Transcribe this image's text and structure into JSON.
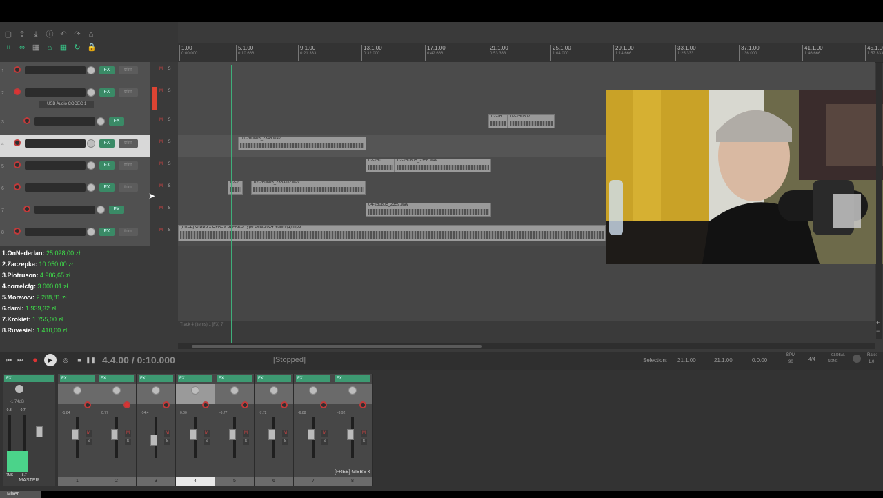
{
  "transport": {
    "position": "4.4.00 / 0:10.000",
    "status": "[Stopped]",
    "selection_label": "Selection:",
    "sel_start": "21.1.00",
    "sel_end": "21.1.00",
    "sel_length": "0.0.00",
    "bpm_label": "BPM",
    "bpm": "90",
    "time_sig": "4/4",
    "global_label": "GLOBAL",
    "global_mode": "NONE",
    "rate_label": "Rate:",
    "rate": "1.0"
  },
  "ruler": {
    "marks": [
      {
        "bar": "1.00",
        "time": "0:00.000"
      },
      {
        "bar": "5.1.00",
        "time": "0:10.666"
      },
      {
        "bar": "9.1.00",
        "time": "0:21.333"
      },
      {
        "bar": "13.1.00",
        "time": "0:32.000"
      },
      {
        "bar": "17.1.00",
        "time": "0:42.666"
      },
      {
        "bar": "21.1.00",
        "time": "0:53.333"
      },
      {
        "bar": "25.1.00",
        "time": "1:04.000"
      },
      {
        "bar": "29.1.00",
        "time": "1:14.666"
      },
      {
        "bar": "33.1.00",
        "time": "1:25.333"
      },
      {
        "bar": "37.1.00",
        "time": "1:36.000"
      },
      {
        "bar": "41.1.00",
        "time": "1:46.666"
      },
      {
        "bar": "45.1.00",
        "time": "1:57.333"
      }
    ]
  },
  "tracks": [
    {
      "num": "1",
      "fx": "FX",
      "trim": "trim"
    },
    {
      "num": "2",
      "fx": "FX",
      "trim": "trim",
      "input": "USB Audio CODEC 1",
      "armed": true
    },
    {
      "num": "3",
      "fx": "FX"
    },
    {
      "num": "4",
      "fx": "FX",
      "trim": "trim"
    },
    {
      "num": "5",
      "fx": "FX",
      "trim": "trim"
    },
    {
      "num": "6",
      "fx": "FX",
      "trim": "trim"
    },
    {
      "num": "7",
      "fx": "FX"
    },
    {
      "num": "8",
      "fx": "FX",
      "trim": "trim"
    }
  ],
  "items": {
    "t3a": "02-26...",
    "t3b": "02-260807...",
    "t4": "01-260805_2348.wav",
    "t5a": "02-260...",
    "t5b": "02-260805_2356.wav",
    "t6a": "02-2...",
    "t6b": "02-260805_2353-02.wav",
    "t7": "04-260805_2359.wav",
    "t8": "[FREE] GIBBS x OPAL x SZPAKU Type Beat 2024 jesień (1).mp3"
  },
  "status_line": "Track 4 (items) 1 [FX] 7",
  "ranking": [
    {
      "user": "1.OnNederlan:",
      "amount": "25 028,00 zł"
    },
    {
      "user": "2.Zaczepka:",
      "amount": "10 050,00 zł"
    },
    {
      "user": "3.Piotruson:",
      "amount": "4 906,65 zł"
    },
    {
      "user": "4.correlcfg:",
      "amount": "3 000,01 zł"
    },
    {
      "user": "5.Moravvv:",
      "amount": "2 288,81 zł"
    },
    {
      "user": "6.dami:",
      "amount": "1 939,32 zł"
    },
    {
      "user": "7.Krokiet:",
      "amount": "1 755,00 zł"
    },
    {
      "user": "8.Ruvesiel:",
      "amount": "1 410,00 zł"
    }
  ],
  "mixer": {
    "master_label": "MASTER",
    "master_fx": "FX",
    "master_db": "-1.74dB",
    "rms_label": "RMS",
    "rms_value": "-8.7",
    "peak_l": "-0.3",
    "peak_r": "-0.7",
    "tab_label": "Mixer",
    "channels": [
      {
        "label": "1",
        "fx": "FX",
        "vol": "-1.84"
      },
      {
        "label": "2",
        "fx": "FX",
        "vol": "0.77"
      },
      {
        "label": "3",
        "fx": "FX",
        "vol": "-14.4"
      },
      {
        "label": "4",
        "fx": "FX",
        "vol": "0.00"
      },
      {
        "label": "5",
        "fx": "FX",
        "vol": "-6.77"
      },
      {
        "label": "6",
        "fx": "FX",
        "vol": "-7.72"
      },
      {
        "label": "7",
        "fx": "FX",
        "vol": "-6.88"
      },
      {
        "label": "8",
        "fx": "FX",
        "vol": "-3.92",
        "name": "[FREE] GIBBS x"
      }
    ]
  },
  "colors": {
    "accent": "#3fae7a",
    "record": "#c23a3a",
    "money": "#3ee04a"
  }
}
